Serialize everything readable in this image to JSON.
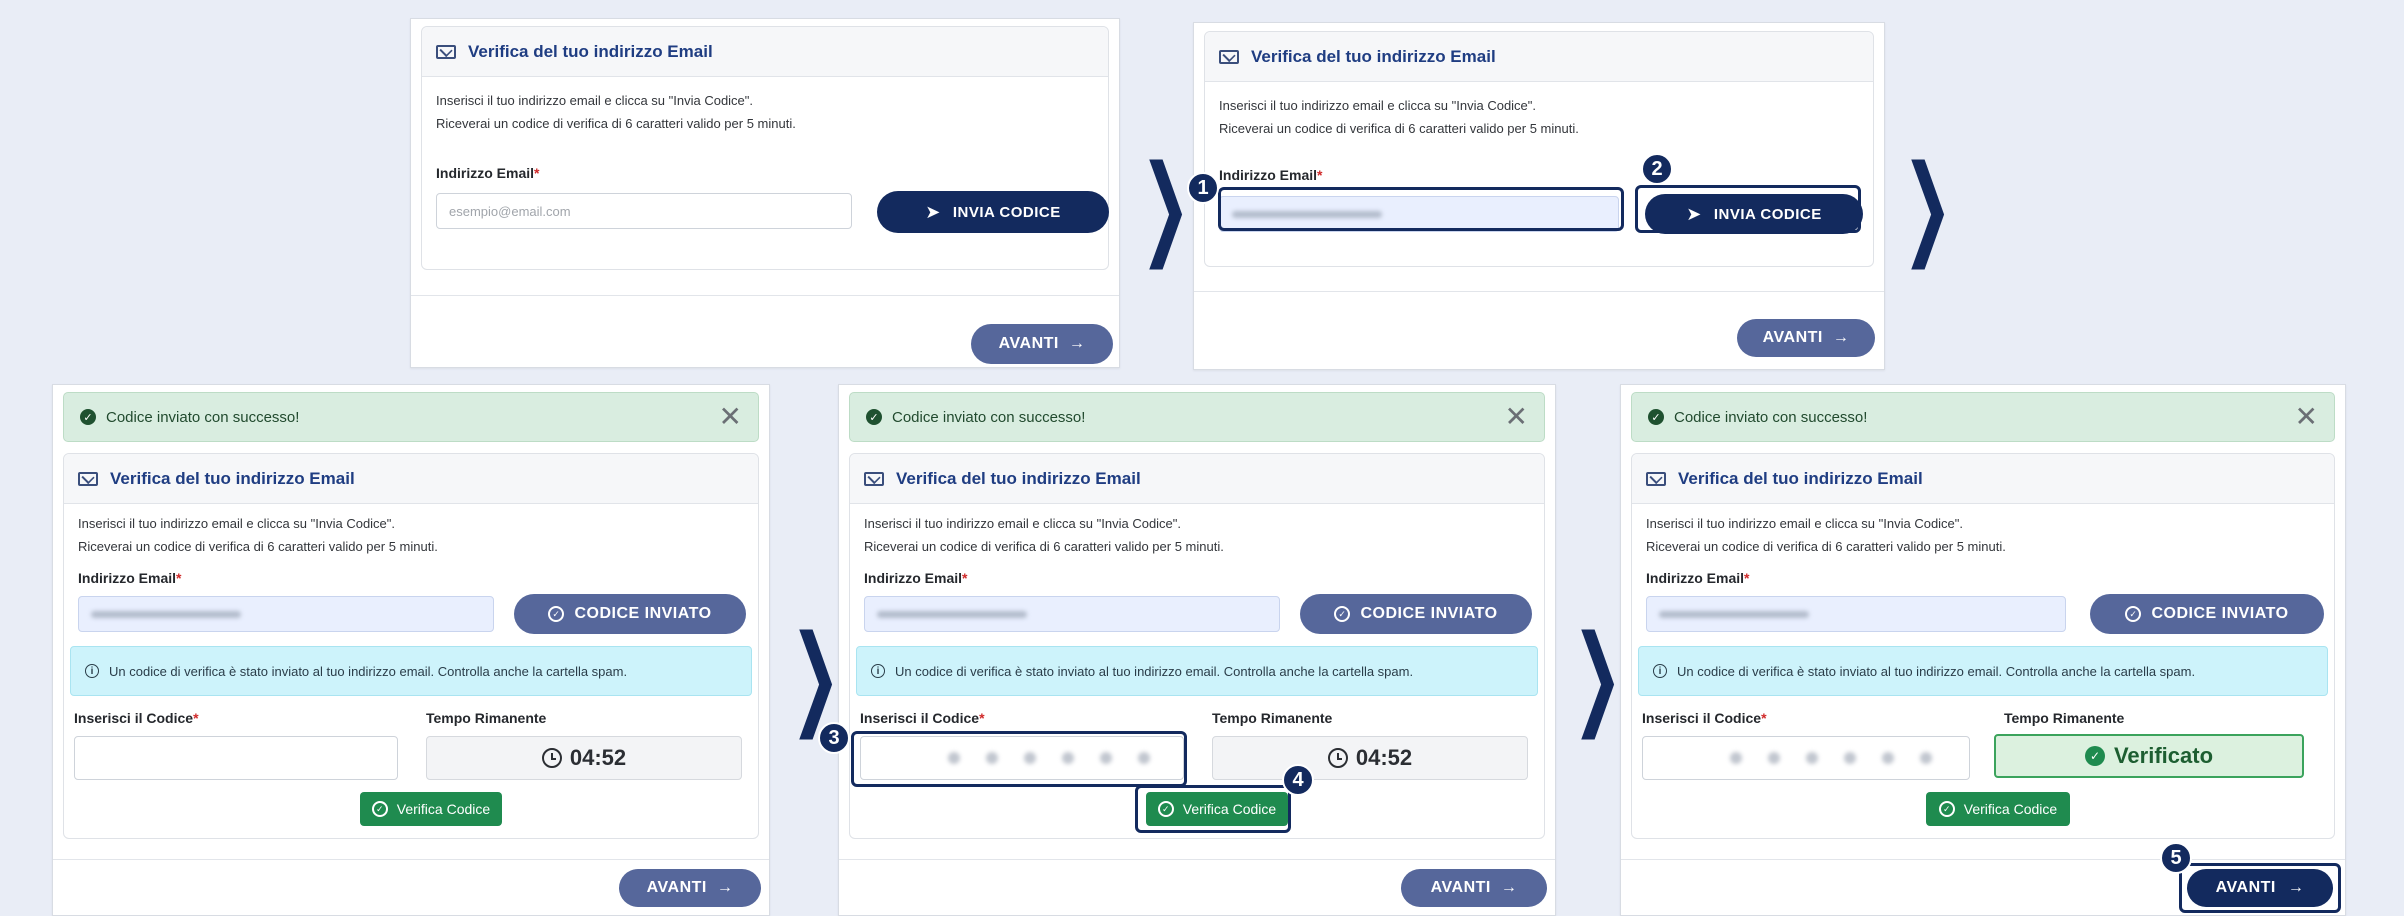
{
  "card": {
    "title": "Verifica del tuo indirizzo Email",
    "desc_line1": "Inserisci il tuo indirizzo email e clicca su \"Invia Codice\".",
    "desc_line2": "Riceverai un codice di verifica di 6 caratteri valido per 5 minuti.",
    "email_label": "Indirizzo Email",
    "email_placeholder": "esempio@email.com",
    "required_mark": "*"
  },
  "buttons": {
    "send_code": "INVIA CODICE",
    "code_sent": "CODICE INVIATO",
    "verify_code": "Verifica Codice",
    "next": "AVANTI",
    "next_arrow": "→"
  },
  "alert": {
    "success_message": "Codice inviato con successo!",
    "close_symbol": "✕"
  },
  "info": {
    "message": "Un codice di verifica è stato inviato al tuo indirizzo email. Controlla anche la cartella spam."
  },
  "code": {
    "label": "Inserisci il Codice",
    "timer_label": "Tempo Rimanente",
    "timer_value": "04:52",
    "verified_text": "Verificato"
  },
  "steps": [
    "1",
    "2",
    "3",
    "4",
    "5"
  ],
  "colors": {
    "primary": "#132a5e",
    "muted_button": "#56679b",
    "success": "#1f8b4f",
    "info_bg": "#cdf3fb",
    "alert_bg": "#d9ede0"
  }
}
